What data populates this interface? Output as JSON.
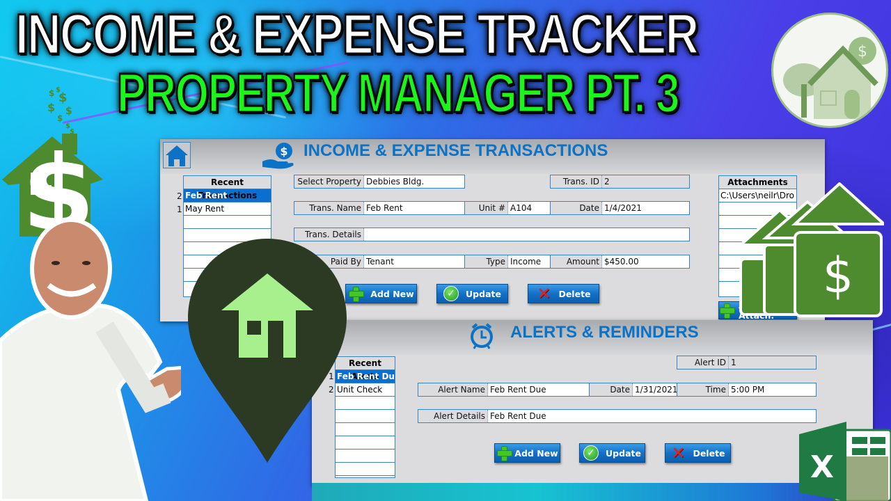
{
  "thumbnail": {
    "title_line1": "INCOME & EXPENSE TRACKER",
    "title_line2": "PROPERTY MANAGER PT. 3",
    "colors": {
      "title_white": "#ffffff",
      "title_green": "#1cf51c",
      "form_accent": "#0b72c6",
      "selected_row": "#0b6fd1",
      "icon_green": "#4e8a2e"
    }
  },
  "transactions_form": {
    "title": "INCOME & EXPENSE TRANSACTIONS",
    "home_icon": "home-icon",
    "title_icon": "hand-dollar-icon",
    "recent_list": {
      "header": "Recent Transactions",
      "rows": [
        {
          "num": "2",
          "label": "Feb Rent",
          "selected": true
        },
        {
          "num": "1",
          "label": "May Rent",
          "selected": false
        }
      ]
    },
    "fields": {
      "select_property": {
        "label": "Select Property",
        "value": "Debbies Bldg."
      },
      "trans_id": {
        "label": "Trans. ID",
        "value": "2"
      },
      "trans_name": {
        "label": "Trans. Name",
        "value": "Feb Rent"
      },
      "unit": {
        "label": "Unit #",
        "value": "A104"
      },
      "date": {
        "label": "Date",
        "value": "1/4/2021"
      },
      "trans_details": {
        "label": "Trans. Details",
        "value": ""
      },
      "paid_by": {
        "label": "Paid By",
        "value": "Tenant"
      },
      "type": {
        "label": "Type",
        "value": "Income"
      },
      "amount": {
        "label": "Amount",
        "value": "$450.00"
      }
    },
    "buttons": {
      "add_new": "Add New",
      "update": "Update",
      "delete": "Delete",
      "add_attach": "Add Attach."
    },
    "attachments": {
      "header": "Attachments",
      "rows": [
        "C:\\Users\\neilr\\Dro"
      ]
    }
  },
  "alerts_form": {
    "title": "ALERTS & REMINDERS",
    "title_icon": "alarm-clock-icon",
    "recent_list": {
      "header": "Recent Alerts",
      "rows": [
        {
          "num": "1",
          "label": "Feb Rent Due",
          "selected": true
        },
        {
          "num": "2",
          "label": "Unit Check",
          "selected": false
        }
      ]
    },
    "fields": {
      "alert_id": {
        "label": "Alert ID",
        "value": "1"
      },
      "alert_name": {
        "label": "Alert Name",
        "value": "Feb Rent Due"
      },
      "date": {
        "label": "Date",
        "value": "1/31/2021"
      },
      "time": {
        "label": "Time",
        "value": "5:00 PM"
      },
      "alert_details": {
        "label": "Alert Details",
        "value": "Feb Rent Due"
      }
    },
    "buttons": {
      "add_new": "Add New",
      "update": "Update",
      "delete": "Delete"
    }
  },
  "decorations": {
    "excel_letter": "X",
    "dollar_sign": "$"
  }
}
